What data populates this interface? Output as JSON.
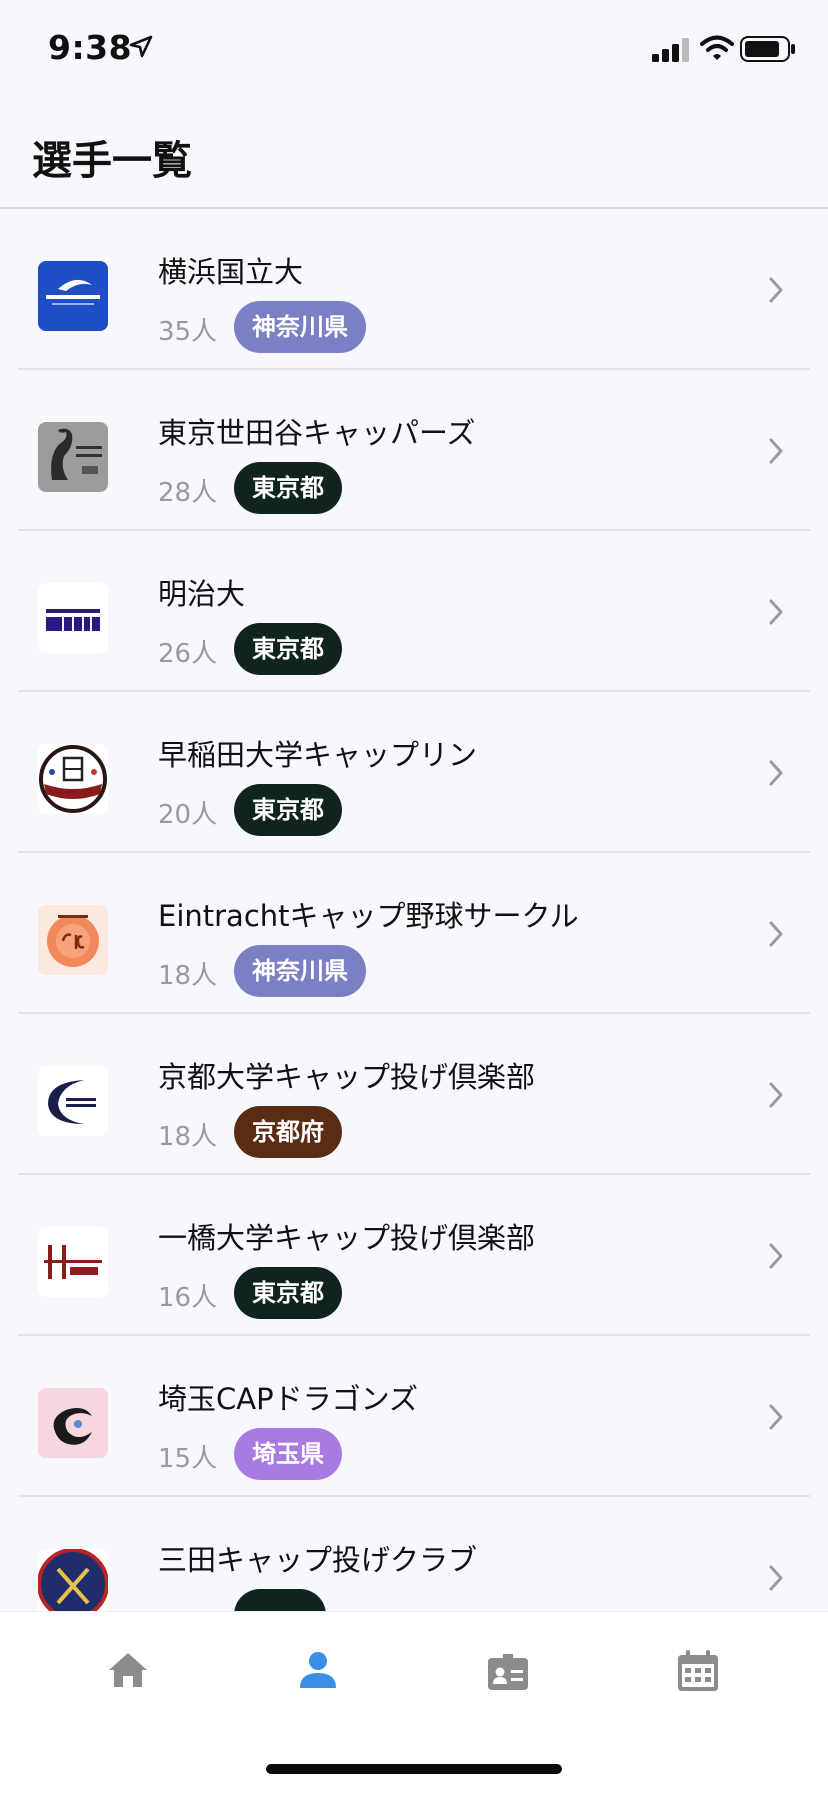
{
  "status_bar": {
    "time": "9:38"
  },
  "header": {
    "title": "選手一覧"
  },
  "teams": [
    {
      "name": "横浜国立大",
      "count": "35人",
      "prefecture": "神奈川県",
      "badge_color": "#7b7fc4",
      "logo": "sounds-on-beach-logo"
    },
    {
      "name": "東京世田谷キャッパーズ",
      "count": "28人",
      "prefecture": "東京都",
      "badge_color": "#10241f",
      "logo": "tsc-logo"
    },
    {
      "name": "明治大",
      "count": "26人",
      "prefecture": "東京都",
      "badge_color": "#10241f",
      "logo": "mucic-logo"
    },
    {
      "name": "早稲田大学キャップリン",
      "count": "20人",
      "prefecture": "東京都",
      "badge_color": "#10241f",
      "logo": "waseda-logo"
    },
    {
      "name": "Eintrachtキャップ野球サークル",
      "count": "18人",
      "prefecture": "神奈川県",
      "badge_color": "#7b7fc4",
      "logo": "etc-logo"
    },
    {
      "name": "京都大学キャップ投げ倶楽部",
      "count": "18人",
      "prefecture": "京都府",
      "badge_color": "#5b2c14",
      "logo": "kucic-logo"
    },
    {
      "name": "一橋大学キャップ投げ倶楽部",
      "count": "16人",
      "prefecture": "東京都",
      "badge_color": "#10241f",
      "logo": "hucic-logo"
    },
    {
      "name": "埼玉CAPドラゴンズ",
      "count": "15人",
      "prefecture": "埼玉県",
      "badge_color": "#a77be0",
      "logo": "dragons-logo"
    },
    {
      "name": "三田キャップ投げクラブ",
      "count": "",
      "prefecture": "",
      "badge_color": "#10241f",
      "logo": "mita-logo"
    }
  ],
  "tab_bar": {
    "items": [
      {
        "icon": "home-icon",
        "active": false
      },
      {
        "icon": "person-icon",
        "active": true
      },
      {
        "icon": "id-badge-icon",
        "active": false
      },
      {
        "icon": "calendar-icon",
        "active": false
      }
    ],
    "active_color": "#3b8ee6",
    "inactive_color": "#8c8c8c"
  }
}
